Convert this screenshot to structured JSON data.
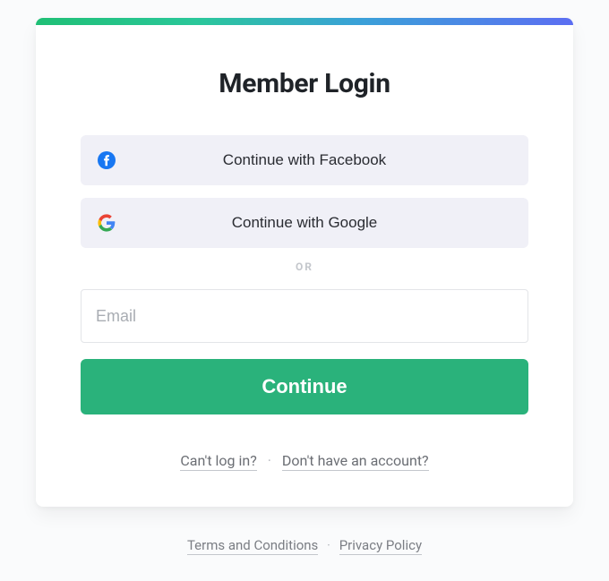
{
  "title": "Member Login",
  "social": {
    "facebook_label": "Continue with Facebook",
    "google_label": "Continue with Google"
  },
  "divider_label": "OR",
  "email_placeholder": "Email",
  "continue_label": "Continue",
  "help": {
    "cant_login": "Can't log in?",
    "no_account": "Don't have an account?"
  },
  "footer": {
    "terms": "Terms and Conditions",
    "privacy": "Privacy Policy"
  }
}
